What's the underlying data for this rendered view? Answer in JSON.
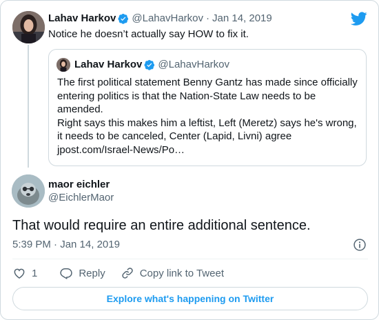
{
  "parent_tweet": {
    "author_name": "Lahav Harkov",
    "handle": "@LahavHarkov",
    "separator": "·",
    "date": "Jan 14, 2019",
    "text": "Notice he doesn’t actually say HOW to fix it."
  },
  "quoted_tweet": {
    "author_name": "Lahav Harkov",
    "handle": "@LahavHarkov",
    "lines": [
      "The first political statement Benny Gantz has made since officially",
      "entering politics is that the Nation-State Law needs to be",
      "amended.",
      "Right says this makes him a leftist, Left (Meretz) says he's wrong,",
      "it needs to be canceled, Center (Lapid, Livni) agree",
      "jpost.com/Israel-News/Po…"
    ]
  },
  "main_tweet": {
    "author_name": "maor eichler",
    "handle": "@EichlerMaor",
    "text": "That would require an entire additional sentence.",
    "timestamp": "5:39 PM · Jan 14, 2019"
  },
  "actions": {
    "like_count": "1",
    "reply_label": "Reply",
    "copy_link_label": "Copy link to Tweet"
  },
  "explore_label": "Explore what's happening on Twitter",
  "colors": {
    "brand_blue": "#1d9bf0",
    "text_primary": "#0f1419",
    "text_secondary": "#536471",
    "border": "#cfd9de"
  },
  "icons": [
    "twitter-bird-icon",
    "verified-badge-icon",
    "info-icon",
    "heart-icon",
    "reply-icon",
    "link-icon"
  ]
}
